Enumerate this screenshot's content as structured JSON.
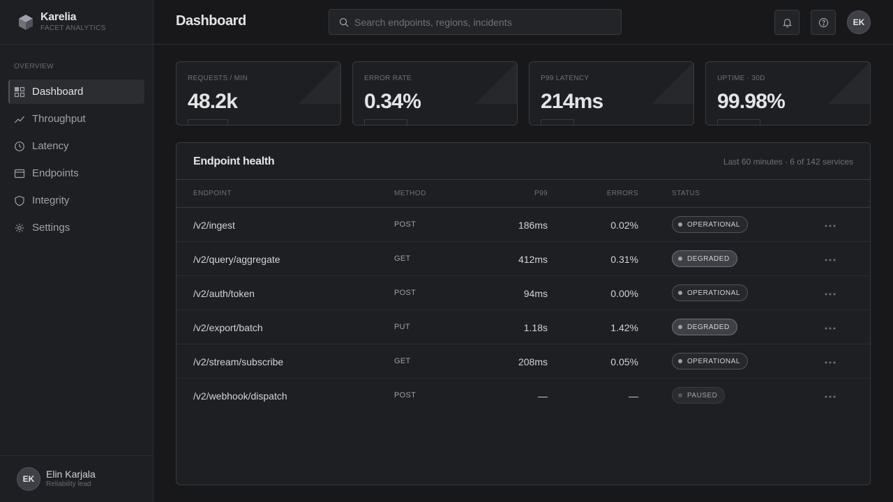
{
  "brand": {
    "name": "Karelia",
    "subtitle": "FACET ANALYTICS"
  },
  "sidebar": {
    "section_label": "OVERVIEW",
    "items": [
      {
        "label": "Dashboard",
        "icon": "grid-icon",
        "active": true
      },
      {
        "label": "Throughput",
        "icon": "trend-line-icon"
      },
      {
        "label": "Latency",
        "icon": "clock-icon"
      },
      {
        "label": "Endpoints",
        "icon": "window-icon"
      },
      {
        "label": "Integrity",
        "icon": "shield-icon"
      },
      {
        "label": "Settings",
        "icon": "gear-icon"
      }
    ],
    "user": {
      "initials": "EK",
      "name": "Elin Karjala",
      "role": "Reliability lead"
    }
  },
  "header": {
    "title": "Dashboard",
    "search_placeholder": "Search endpoints, regions, incidents",
    "avatar_initials": "EK"
  },
  "kpis": [
    {
      "label": "REQUESTS / MIN",
      "value": "48.2k"
    },
    {
      "label": "ERROR RATE",
      "value": "0.34%"
    },
    {
      "label": "P99 LATENCY",
      "value": "214ms"
    },
    {
      "label": "UPTIME · 30D",
      "value": "99.98%"
    }
  ],
  "table": {
    "title": "Endpoint health",
    "meta": "Last 60 minutes · 6 of 142 services",
    "columns": {
      "endpoint": "ENDPOINT",
      "method": "METHOD",
      "p99": "P99",
      "errors": "ERRORS",
      "status": "STATUS"
    },
    "rows": [
      {
        "endpoint": "/v2/ingest",
        "method": "POST",
        "p99": "186ms",
        "errors": "0.02%",
        "status": "OPERATIONAL",
        "status_kind": "operational"
      },
      {
        "endpoint": "/v2/query/aggregate",
        "method": "GET",
        "p99": "412ms",
        "errors": "0.31%",
        "status": "DEGRADED",
        "status_kind": "degraded"
      },
      {
        "endpoint": "/v2/auth/token",
        "method": "POST",
        "p99": "94ms",
        "errors": "0.00%",
        "status": "OPERATIONAL",
        "status_kind": "operational"
      },
      {
        "endpoint": "/v2/export/batch",
        "method": "PUT",
        "p99": "1.18s",
        "errors": "1.42%",
        "status": "DEGRADED",
        "status_kind": "degraded"
      },
      {
        "endpoint": "/v2/stream/subscribe",
        "method": "GET",
        "p99": "208ms",
        "errors": "0.05%",
        "status": "OPERATIONAL",
        "status_kind": "operational"
      },
      {
        "endpoint": "/v2/webhook/dispatch",
        "method": "POST",
        "p99": "—",
        "errors": "—",
        "status": "PAUSED",
        "status_kind": "paused"
      }
    ]
  },
  "colors": {
    "background": "#18181b",
    "panel": "#1e1f22",
    "border": "#3a3b40",
    "text": "#d4d4d8"
  }
}
